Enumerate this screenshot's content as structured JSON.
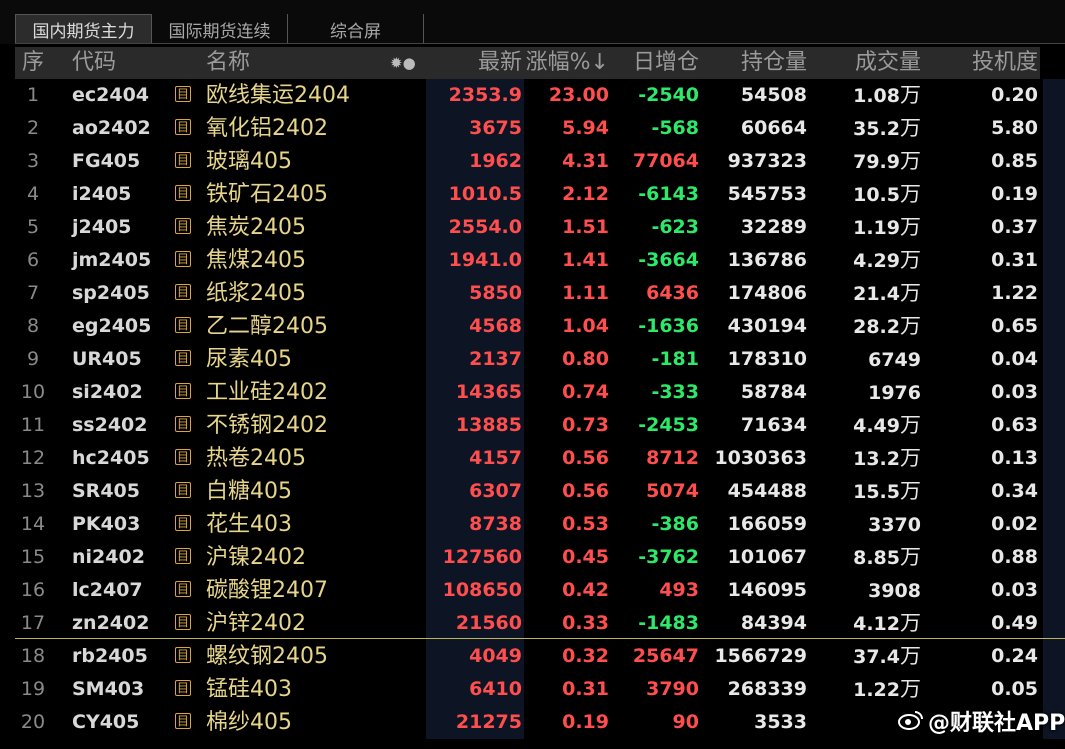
{
  "tabs": [
    {
      "label": "国内期货主力",
      "active": true
    },
    {
      "label": "国际期货连续",
      "active": false
    },
    {
      "label": "综合屏",
      "active": false
    }
  ],
  "header": {
    "seq": "序",
    "code": "代码",
    "name": "名称",
    "icons": "✹●",
    "last": "最新",
    "change_pct": "涨幅%↓",
    "daily_oi_change": "日增仓",
    "open_interest": "持仓量",
    "volume": "成交量",
    "speculation": "投机度"
  },
  "rows": [
    {
      "seq": "1",
      "code": "ec2404",
      "name": "欧线集运2404",
      "last": "2353.9",
      "pct": "23.00",
      "chg": "-2540",
      "oi": "54508",
      "vol": "1.08",
      "vol_unit": "万",
      "spec": "0.20"
    },
    {
      "seq": "2",
      "code": "ao2402",
      "name": "氧化铝2402",
      "last": "3675",
      "pct": "5.94",
      "chg": "-568",
      "oi": "60664",
      "vol": "35.2",
      "vol_unit": "万",
      "spec": "5.80"
    },
    {
      "seq": "3",
      "code": "FG405",
      "name": "玻璃405",
      "last": "1962",
      "pct": "4.31",
      "chg": "77064",
      "oi": "937323",
      "vol": "79.9",
      "vol_unit": "万",
      "spec": "0.85"
    },
    {
      "seq": "4",
      "code": "i2405",
      "name": "铁矿石2405",
      "last": "1010.5",
      "pct": "2.12",
      "chg": "-6143",
      "oi": "545753",
      "vol": "10.5",
      "vol_unit": "万",
      "spec": "0.19"
    },
    {
      "seq": "5",
      "code": "j2405",
      "name": "焦炭2405",
      "last": "2554.0",
      "pct": "1.51",
      "chg": "-623",
      "oi": "32289",
      "vol": "1.19",
      "vol_unit": "万",
      "spec": "0.37"
    },
    {
      "seq": "6",
      "code": "jm2405",
      "name": "焦煤2405",
      "last": "1941.0",
      "pct": "1.41",
      "chg": "-3664",
      "oi": "136786",
      "vol": "4.29",
      "vol_unit": "万",
      "spec": "0.31"
    },
    {
      "seq": "7",
      "code": "sp2405",
      "name": "纸浆2405",
      "last": "5850",
      "pct": "1.11",
      "chg": "6436",
      "oi": "174806",
      "vol": "21.4",
      "vol_unit": "万",
      "spec": "1.22"
    },
    {
      "seq": "8",
      "code": "eg2405",
      "name": "乙二醇2405",
      "last": "4568",
      "pct": "1.04",
      "chg": "-1636",
      "oi": "430194",
      "vol": "28.2",
      "vol_unit": "万",
      "spec": "0.65"
    },
    {
      "seq": "9",
      "code": "UR405",
      "name": "尿素405",
      "last": "2137",
      "pct": "0.80",
      "chg": "-181",
      "oi": "178310",
      "vol": "6749",
      "vol_unit": "",
      "spec": "0.04"
    },
    {
      "seq": "10",
      "code": "si2402",
      "name": "工业硅2402",
      "last": "14365",
      "pct": "0.74",
      "chg": "-333",
      "oi": "58784",
      "vol": "1976",
      "vol_unit": "",
      "spec": "0.03"
    },
    {
      "seq": "11",
      "code": "ss2402",
      "name": "不锈钢2402",
      "last": "13885",
      "pct": "0.73",
      "chg": "-2453",
      "oi": "71634",
      "vol": "4.49",
      "vol_unit": "万",
      "spec": "0.63"
    },
    {
      "seq": "12",
      "code": "hc2405",
      "name": "热卷2405",
      "last": "4157",
      "pct": "0.56",
      "chg": "8712",
      "oi": "1030363",
      "vol": "13.2",
      "vol_unit": "万",
      "spec": "0.13"
    },
    {
      "seq": "13",
      "code": "SR405",
      "name": "白糖405",
      "last": "6307",
      "pct": "0.56",
      "chg": "5074",
      "oi": "454488",
      "vol": "15.5",
      "vol_unit": "万",
      "spec": "0.34"
    },
    {
      "seq": "14",
      "code": "PK403",
      "name": "花生403",
      "last": "8738",
      "pct": "0.53",
      "chg": "-386",
      "oi": "166059",
      "vol": "3370",
      "vol_unit": "",
      "spec": "0.02"
    },
    {
      "seq": "15",
      "code": "ni2402",
      "name": "沪镍2402",
      "last": "127560",
      "pct": "0.45",
      "chg": "-3762",
      "oi": "101067",
      "vol": "8.85",
      "vol_unit": "万",
      "spec": "0.88"
    },
    {
      "seq": "16",
      "code": "lc2407",
      "name": "碳酸锂2407",
      "last": "108650",
      "pct": "0.42",
      "chg": "493",
      "oi": "146095",
      "vol": "3908",
      "vol_unit": "",
      "spec": "0.03"
    },
    {
      "seq": "17",
      "code": "zn2402",
      "name": "沪锌2402",
      "last": "21560",
      "pct": "0.33",
      "chg": "-1483",
      "oi": "84394",
      "vol": "4.12",
      "vol_unit": "万",
      "spec": "0.49"
    },
    {
      "seq": "18",
      "code": "rb2405",
      "name": "螺纹钢2405",
      "last": "4049",
      "pct": "0.32",
      "chg": "25647",
      "oi": "1566729",
      "vol": "37.4",
      "vol_unit": "万",
      "spec": "0.24"
    },
    {
      "seq": "19",
      "code": "SM403",
      "name": "锰硅403",
      "last": "6410",
      "pct": "0.31",
      "chg": "3790",
      "oi": "268339",
      "vol": "1.22",
      "vol_unit": "万",
      "spec": "0.05"
    },
    {
      "seq": "20",
      "code": "CY405",
      "name": "棉纱405",
      "last": "21275",
      "pct": "0.19",
      "chg": "90",
      "oi": "3533",
      "vol": "",
      "vol_unit": "",
      "spec": ""
    }
  ],
  "row_icon": "目",
  "watermark": {
    "text": "@财联社APP"
  },
  "colors": {
    "up": "#ff4e4e",
    "down": "#2ee86a",
    "name": "#e6d58a",
    "icon": "#d9a441"
  }
}
